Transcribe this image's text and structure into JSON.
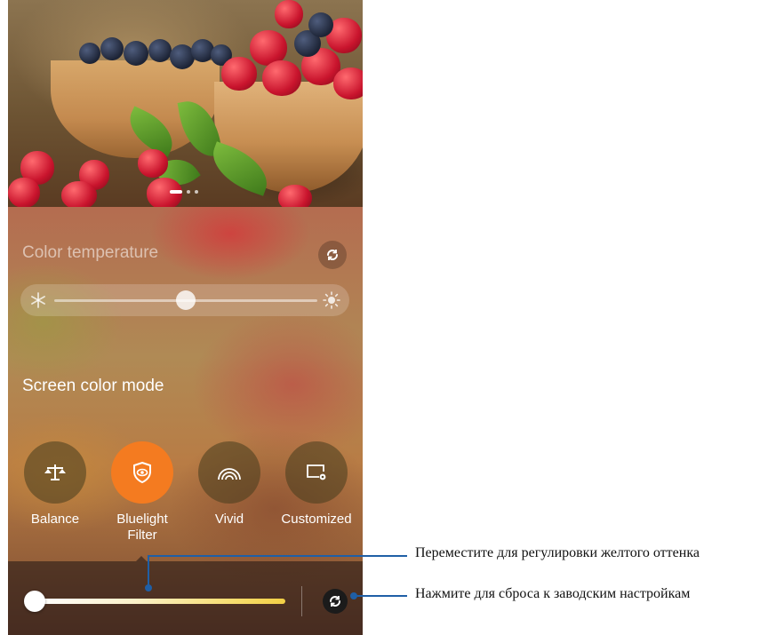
{
  "color_temperature": {
    "label": "Color temperature",
    "slider_value": 0.5
  },
  "screen_color_mode": {
    "label": "Screen color mode",
    "modes": [
      {
        "label": "Balance",
        "icon": "scale-icon",
        "selected": false
      },
      {
        "label": "Bluelight Filter",
        "icon": "eye-shield-icon",
        "selected": true
      },
      {
        "label": "Vivid",
        "icon": "rainbow-icon",
        "selected": false
      },
      {
        "label": "Customized",
        "icon": "screen-settings-icon",
        "selected": false
      }
    ]
  },
  "bluelight_filter": {
    "slider_value": 0.0
  },
  "annotations": {
    "slider_note": "Переместите для регулировки желтого оттенка",
    "reset_note": "Нажмите для сброса к заводским настройкам"
  },
  "colors": {
    "accent": "#f47b20",
    "annotation": "#1f5fa6"
  }
}
